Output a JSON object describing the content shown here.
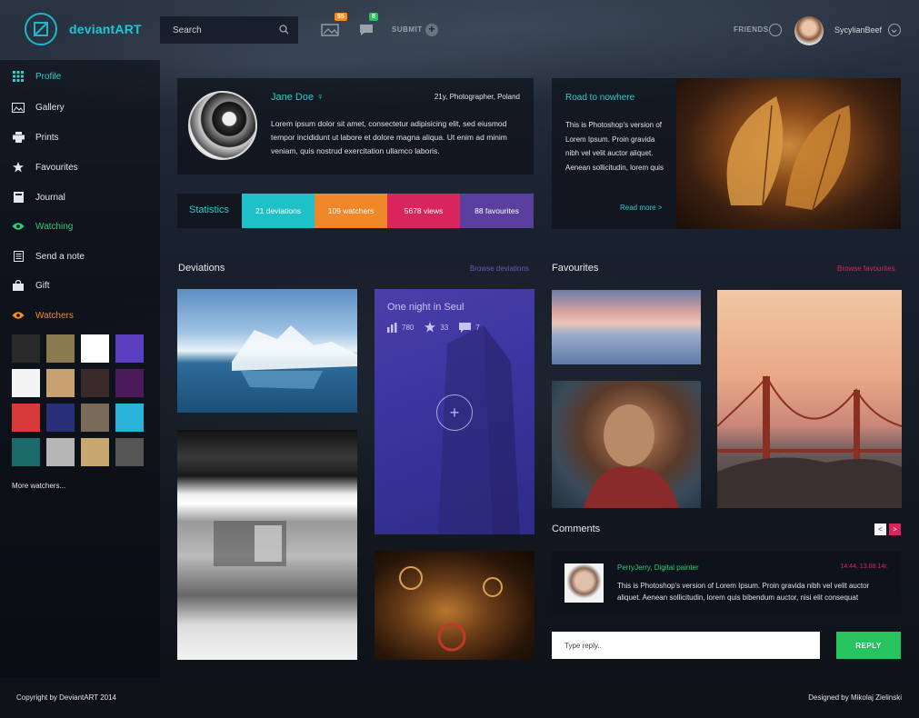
{
  "brand": {
    "name": "deviantART",
    "accent": "#1fb6c9"
  },
  "header": {
    "search_placeholder": "Search",
    "notifications_badge": "55",
    "messages_badge": "8",
    "submit_label": "SUBMIT",
    "friends_label": "FRIENDS",
    "username": "SycylianBeef"
  },
  "sidebar": {
    "items": [
      {
        "label": "Profile",
        "icon": "grid-icon"
      },
      {
        "label": "Gallery",
        "icon": "image-icon"
      },
      {
        "label": "Prints",
        "icon": "printer-icon"
      },
      {
        "label": "Favourites",
        "icon": "star-icon"
      },
      {
        "label": "Journal",
        "icon": "book-icon"
      },
      {
        "label": "Watching",
        "icon": "eye-icon"
      },
      {
        "label": "Send a note",
        "icon": "note-icon"
      },
      {
        "label": "Gift",
        "icon": "bag-icon"
      },
      {
        "label": "Watchers",
        "icon": "eye-icon"
      }
    ],
    "watchers": [
      {
        "color": "#2a2a2a"
      },
      {
        "color": "#8a7a50"
      },
      {
        "color": "#ffffff"
      },
      {
        "color": "#5a3fbf"
      },
      {
        "color": "#f4f4f4"
      },
      {
        "color": "#c9a070"
      },
      {
        "color": "#3a2a2a"
      },
      {
        "color": "#4a1a5a"
      },
      {
        "color": "#d83a3a"
      },
      {
        "color": "#2a2f7a"
      },
      {
        "color": "#7a6a5a"
      },
      {
        "color": "#2ab3d8"
      },
      {
        "color": "#1a6a6a"
      },
      {
        "color": "#b5b5b5"
      },
      {
        "color": "#c9a870"
      },
      {
        "color": "#555555"
      }
    ],
    "more_watchers": "More watchers..."
  },
  "profile": {
    "name": "Jane Doe ♀",
    "meta": "21y, Photographer, Poland",
    "bio": "Lorem ipsum dolor sit amet, consectetur adipisicing elit, sed eiusmod tempor incididunt ut labore et dolore magna aliqua. Ut enim ad minim veniam, quis nostrud exercitation ullamco laboris."
  },
  "statistics": {
    "label": "Statistics",
    "items": [
      {
        "label": "21 deviations",
        "color": "#1fc0c8"
      },
      {
        "label": "109 watchers",
        "color": "#f0882a"
      },
      {
        "label": "5678 views",
        "color": "#d8255c"
      },
      {
        "label": "88 favourites",
        "color": "#5a3fa0"
      }
    ]
  },
  "road": {
    "title": "Road to nowhere",
    "text": "This is Photoshop's version  of Lorem Ipsum. Proin gravida nibh vel velit auctor aliquet. Aenean sollicitudin, lorem quis",
    "read_more": "Read more >"
  },
  "deviations": {
    "title": "Deviations",
    "link": "Browse deviations",
    "link_color": "#6a5ab8",
    "featured": {
      "title": "One night in Seul",
      "views": "780",
      "favs": "33",
      "comments": "7"
    }
  },
  "favourites": {
    "title": "Favourites",
    "link": "Browse favourites",
    "link_color": "#d8255c"
  },
  "comments": {
    "title": "Comments",
    "prev": "<",
    "next": ">",
    "author": "PerryJerry, Digital painter",
    "time": "14:44, 13.08.14r.",
    "text": "This is Photoshop's version  of Lorem Ipsum. Proin gravida nibh vel velit auctor aliquet. Aenean sollicitudin, lorem quis bibendum auctor, nisi elit consequat"
  },
  "reply": {
    "placeholder": "Type reply..",
    "button": "REPLY"
  },
  "footer": {
    "left": "Copyright by DeviantART 2014",
    "right": "Designed by Mikolaj Zielinski"
  }
}
